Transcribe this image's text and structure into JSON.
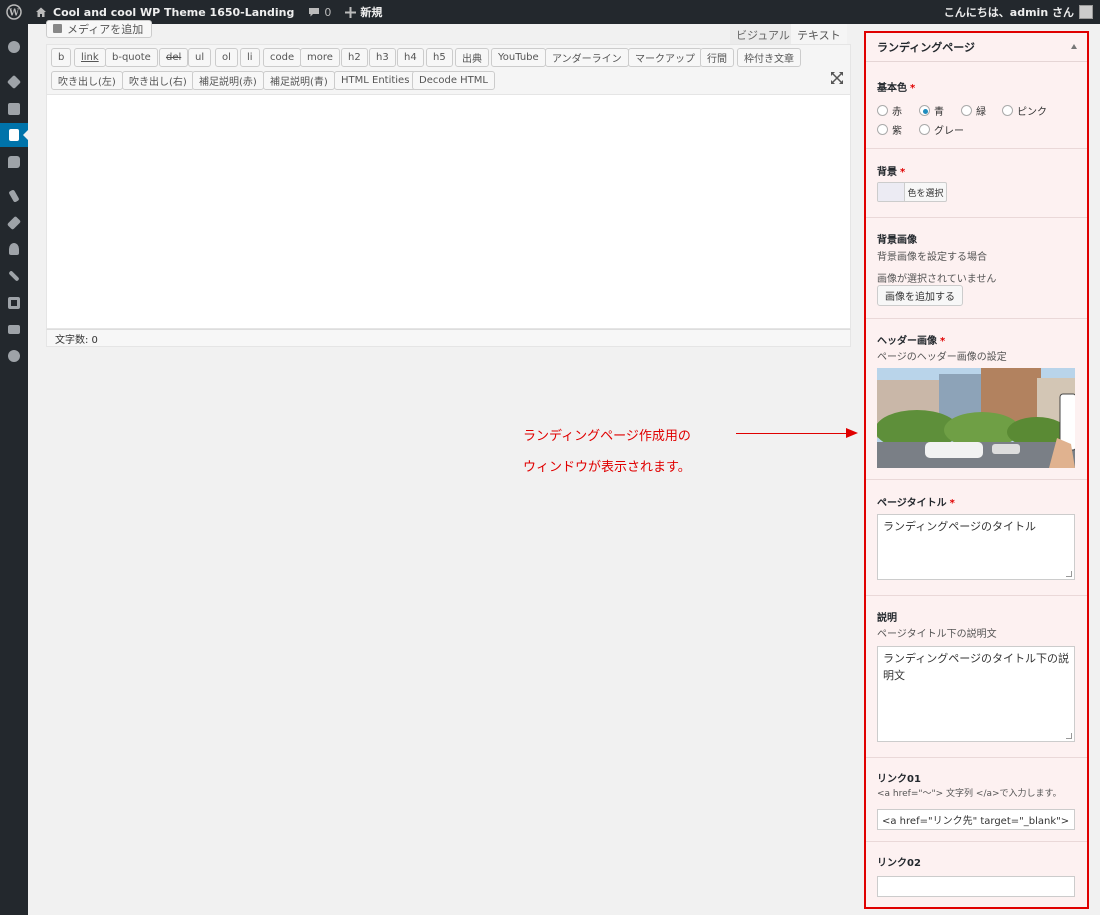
{
  "adminbar": {
    "site_name": "Cool and cool WP Theme 1650-Landing",
    "comment_count": "0",
    "new_label": "新規",
    "greeting": "こんにちは、admin さん"
  },
  "editor": {
    "media_button": "メディアを追加",
    "tab_visual": "ビジュアル",
    "tab_text": "テキスト",
    "buttons_row1": [
      "b",
      "link",
      "b-quote",
      "del",
      "ul",
      "ol",
      "li",
      "code",
      "more",
      "h2",
      "h3",
      "h4",
      "h5",
      "出典",
      "YouTube",
      "アンダーライン",
      "マークアップ",
      "行間",
      "枠付き文章"
    ],
    "buttons_row2": [
      "吹き出し(左)",
      "吹き出し(右)",
      "補足説明(赤)",
      "補足説明(青)",
      "HTML Entities",
      "Decode HTML"
    ],
    "word_count": "文字数: 0"
  },
  "annotation": {
    "line1": "ランディングページ作成用の",
    "line2": "ウィンドウが表示されます。"
  },
  "metabox": {
    "title": "ランディングページ",
    "base_color": {
      "label": "基本色",
      "required": "*",
      "options": [
        "赤",
        "青",
        "緑",
        "ピンク",
        "紫",
        "グレー"
      ],
      "selected": "青"
    },
    "background": {
      "label": "背景",
      "required": "*",
      "button": "色を選択"
    },
    "background_image": {
      "label": "背景画像",
      "desc": "背景画像を設定する場合",
      "status": "画像が選択されていません",
      "button": "画像を追加する"
    },
    "header_image": {
      "label": "ヘッダー画像",
      "required": "*",
      "desc": "ページのヘッダー画像の設定"
    },
    "page_title": {
      "label": "ページタイトル",
      "required": "*",
      "value": "ランディングページのタイトル"
    },
    "description": {
      "label": "説明",
      "desc": "ページタイトル下の説明文",
      "value": "ランディングページのタイトル下の説明文"
    },
    "link01": {
      "label": "リンク01",
      "desc": "<a href=\"〜\"> 文字列 </a>で入力します。",
      "value": "<a href=\"リンク先\" target=\"_blank\">"
    },
    "link02": {
      "label": "リンク02",
      "value": ""
    }
  },
  "colors": {
    "accent": "#0073aa",
    "annotation_red": "#e00000",
    "adminbar_bg": "#23282d"
  }
}
